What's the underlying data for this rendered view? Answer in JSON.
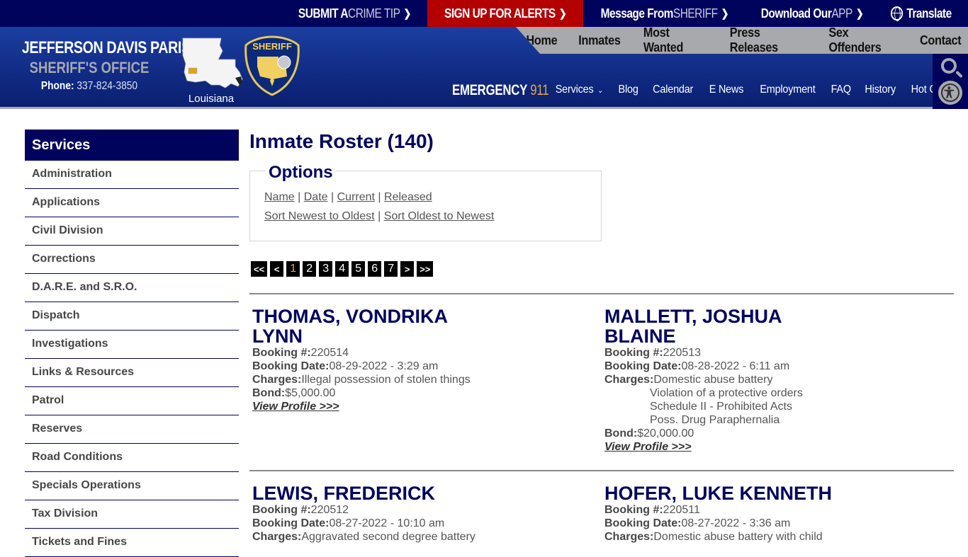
{
  "topbar": {
    "links": [
      {
        "pre": "SUBMIT A ",
        "hl": "CRIME TIP",
        "chev": "❯"
      },
      {
        "pre": "SIGN UP FOR ALERTS",
        "hl": "",
        "chev": "❯"
      },
      {
        "pre": "Message From ",
        "hl": "SHERIFF",
        "chev": "❯"
      },
      {
        "pre": "Download Our ",
        "hl": "APP",
        "chev": "❯"
      }
    ],
    "translate": "Translate"
  },
  "brand": {
    "line1": "JEFFERSON DAVIS PARISH",
    "line2": "SHERIFF'S OFFICE",
    "phone_label": "Phone:",
    "phone": "337-824-3850",
    "map_label": "Louisiana",
    "badge_text": "SHERIFF"
  },
  "colors": {
    "navy": "#00035c",
    "alert_red": "#b30000",
    "gold": "#e5a93b",
    "gray": "#a8a9ad"
  },
  "mainnav": [
    "Home",
    "Inmates",
    "Most Wanted",
    "Press Releases",
    "Sex Offenders",
    "Contact"
  ],
  "emergency": {
    "label": "EMERGENCY",
    "number": "911"
  },
  "subnav": [
    "Services",
    "Blog",
    "Calendar",
    "E News",
    "Employment",
    "FAQ",
    "History",
    "Hot Cases"
  ],
  "subnav_dropdown_glyph": "⌄",
  "tools": {
    "search_icon": "search-icon",
    "accessibility_icon": "accessibility-icon"
  },
  "sidebar": {
    "title": "Services",
    "items": [
      "Administration",
      "Applications",
      "Civil Division",
      "Corrections",
      "D.A.R.E. and S.R.O.",
      "Dispatch",
      "Investigations",
      "Links & Resources",
      "Patrol",
      "Reserves",
      "Road Conditions",
      "Specials Operations",
      "Tax Division",
      "Tickets and Fines"
    ]
  },
  "main": {
    "title": "Inmate Roster (140)",
    "options": {
      "legend": "Options",
      "filters": [
        "Name",
        "Date",
        "Current",
        "Released"
      ],
      "sorts": [
        "Sort Newest to Oldest",
        "Sort Oldest to Newest"
      ],
      "sep": "|"
    },
    "pager": {
      "first": "<<",
      "prev": "<",
      "pages": [
        "1",
        "2",
        "3",
        "4",
        "5",
        "6",
        "7"
      ],
      "current": "1",
      "next": ">",
      "last": ">>"
    },
    "labels": {
      "booking_no": "Booking #:",
      "booking_date": "Booking Date:",
      "charges": "Charges:",
      "bond": "Bond:",
      "view_profile": "View Profile >>>"
    },
    "inmates": [
      {
        "name_l1": "THOMAS, VONDRIKA",
        "name_l2": "LYNN",
        "booking_no": "220514",
        "booking_date": "08-29-2022 - 3:29 am",
        "charges": [
          "Illegal possession of stolen things"
        ],
        "bond": "$5,000.00"
      },
      {
        "name_l1": "MALLETT, JOSHUA",
        "name_l2": "BLAINE",
        "booking_no": "220513",
        "booking_date": "08-28-2022 - 6:11 am",
        "charges": [
          "Domestic abuse battery",
          "Violation of a protective orders",
          "Schedule II - Prohibited Acts",
          "Poss. Drug Paraphernalia"
        ],
        "bond": "$20,000.00"
      },
      {
        "name_l1": "LEWIS, FREDERICK",
        "name_l2": "",
        "booking_no": "220512",
        "booking_date": "08-27-2022 - 10:10 am",
        "charges": [
          "Aggravated second degree battery"
        ],
        "bond": ""
      },
      {
        "name_l1": "HOFER, LUKE KENNETH",
        "name_l2": "",
        "booking_no": "220511",
        "booking_date": "08-27-2022 - 3:36 am",
        "charges": [
          "Domestic abuse battery with child"
        ],
        "bond": ""
      }
    ]
  }
}
